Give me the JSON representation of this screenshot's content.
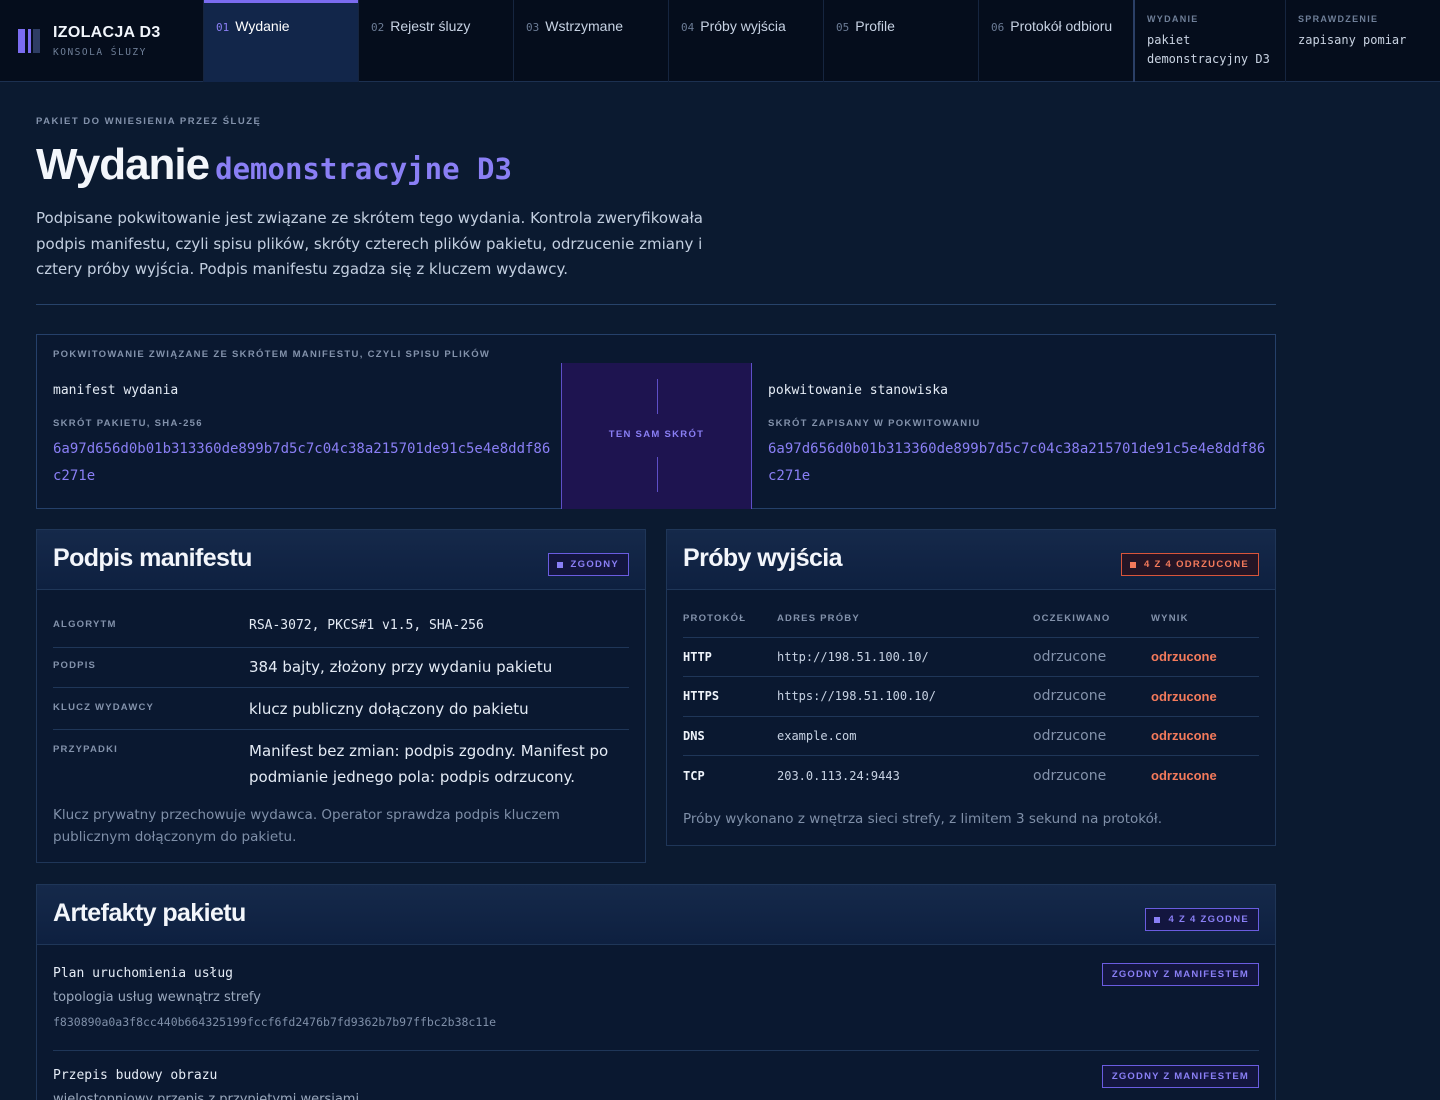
{
  "brand": {
    "title": "IZOLACJA D3",
    "subtitle": "KONSOLA ŚLUZY"
  },
  "nav": [
    {
      "num": "01",
      "label": "Wydanie"
    },
    {
      "num": "02",
      "label": "Rejestr śluzy"
    },
    {
      "num": "03",
      "label": "Wstrzymane"
    },
    {
      "num": "04",
      "label": "Próby wyjścia"
    },
    {
      "num": "05",
      "label": "Profile"
    },
    {
      "num": "06",
      "label": "Protokół odbioru"
    }
  ],
  "meta": [
    {
      "key": "WYDANIE",
      "value": "pakiet demonstracyjny D3"
    },
    {
      "key": "SPRAWDZENIE",
      "value": "zapisany pomiar"
    }
  ],
  "intro": {
    "eyebrow": "PAKIET DO WNIESIENIA PRZEZ ŚLUZĘ",
    "title": "Wydanie",
    "title_mono": "demonstracyjne D3",
    "lead": "Podpisane pokwitowanie jest związane ze skrótem tego wydania. Kontrola zweryfikowała podpis manifestu, czyli spisu plików, skróty czterech plików pakietu, odrzucenie zmiany i cztery próby wyjścia. Podpis manifestu zgadza się z kluczem wydawcy."
  },
  "receipt": {
    "heading": "POKWITOWANIE ZWIĄZANE ZE SKRÓTEM MANIFESTU, CZYLI SPISU PLIKÓW",
    "left": {
      "name": "manifest wydania",
      "key": "SKRÓT PAKIETU, SHA-256",
      "hash": "6a97d656d0b01b313360de899b7d5c7c04c38a215701de91c5e4e8ddf86c271e"
    },
    "middle": "TEN SAM SKRÓT",
    "right": {
      "name": "pokwitowanie stanowiska",
      "key": "SKRÓT ZAPISANY W POKWITOWANIU",
      "hash": "6a97d656d0b01b313360de899b7d5c7c04c38a215701de91c5e4e8ddf86c271e"
    }
  },
  "signature": {
    "title": "Podpis manifestu",
    "badge": "ZGODNY",
    "rows": [
      {
        "key": "ALGORYTM",
        "value": "RSA-3072, PKCS#1 v1.5, SHA-256"
      },
      {
        "key": "PODPIS",
        "value": "384 bajty, złożony przy wydaniu pakietu"
      },
      {
        "key": "KLUCZ WYDAWCY",
        "value": "klucz publiczny dołączony do pakietu"
      },
      {
        "key": "PRZYPADKI",
        "value": "Manifest bez zmian: podpis zgodny. Manifest po podmianie jednego pola: podpis odrzucony."
      }
    ],
    "note": "Klucz prywatny przechowuje wydawca. Operator sprawdza podpis kluczem publicznym dołączonym do pakietu."
  },
  "probes": {
    "title": "Próby wyjścia",
    "badge": "4 Z 4 ODRZUCONE",
    "headers": [
      "PROTOKÓŁ",
      "ADRES PRÓBY",
      "OCZEKIWANO",
      "WYNIK"
    ],
    "rows": [
      {
        "protocol": "HTTP",
        "address": "http://198.51.100.10/",
        "expected": "odrzucone",
        "result": "odrzucone"
      },
      {
        "protocol": "HTTPS",
        "address": "https://198.51.100.10/",
        "expected": "odrzucone",
        "result": "odrzucone"
      },
      {
        "protocol": "DNS",
        "address": "example.com",
        "expected": "odrzucone",
        "result": "odrzucone"
      },
      {
        "protocol": "TCP",
        "address": "203.0.113.24:9443",
        "expected": "odrzucone",
        "result": "odrzucone"
      }
    ],
    "note": "Próby wykonano z wnętrza sieci strefy, z limitem 3 sekund na protokół."
  },
  "artifacts": {
    "title": "Artefakty pakietu",
    "badge": "4 Z 4 ZGODNE",
    "items": [
      {
        "name": "Plan uruchomienia usług",
        "desc": "topologia usług wewnątrz strefy",
        "hash": "f830890a0a3f8cc440b664325199fccf6fd2476b7fd9362b7b97ffbc2b38c11e",
        "tag": "ZGODNY Z MANIFESTEM"
      },
      {
        "name": "Przepis budowy obrazu",
        "desc": "wielostopniowy przepis z przypiętymi wersjami",
        "tag": "ZGODNY Z MANIFESTEM"
      }
    ]
  }
}
